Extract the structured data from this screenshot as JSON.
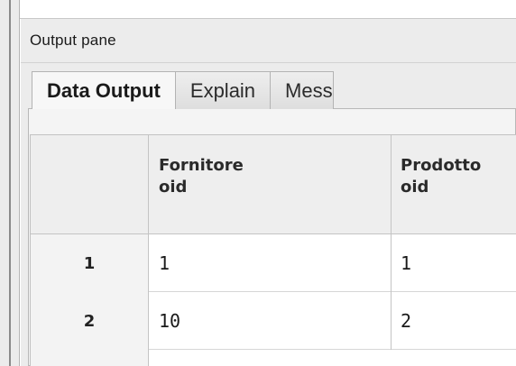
{
  "pane": {
    "title": "Output pane",
    "tabs": [
      {
        "label": "Data Output",
        "active": true
      },
      {
        "label": "Explain",
        "active": false
      },
      {
        "label": "Mess",
        "active": false
      }
    ]
  },
  "grid": {
    "columns": [
      {
        "name": "",
        "type": ""
      },
      {
        "name": "Fornitore",
        "type": "oid"
      },
      {
        "name": "Prodotto",
        "type": "oid"
      }
    ],
    "rows": [
      {
        "num": "1",
        "cells": [
          "1",
          "1"
        ]
      },
      {
        "num": "2",
        "cells": [
          "10",
          "2"
        ]
      }
    ]
  }
}
